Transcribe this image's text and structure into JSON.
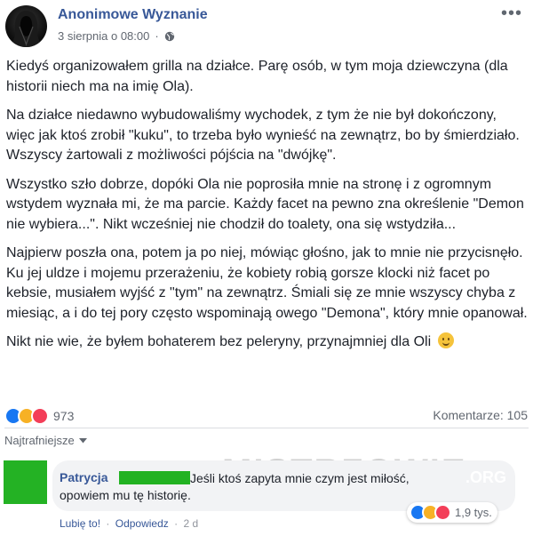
{
  "post": {
    "page_name": "Anonimowe Wyznanie",
    "date": "3 sierpnia o 08:00",
    "more_icon": "more-options-icon",
    "paragraphs": [
      "Kiedyś organizowałem grilla na działce. Parę osób, w tym moja dziewczyna (dla historii niech ma na imię Ola).",
      "Na działce niedawno wybudowaliśmy wychodek, z tym że nie był dokończony, więc jak ktoś zrobił \"kuku\", to trzeba było wynieść na zewnątrz, bo by śmierdziało. Wszyscy żartowali z możliwości pójścia na \"dwójkę\".",
      "Wszystko szło dobrze, dopóki Ola nie poprosiła mnie na stronę i z ogromnym wstydem wyznała mi, że ma parcie. Każdy facet na pewno zna określenie \"Demon nie wybiera...\". Nikt wcześniej nie chodził do toalety, ona się wstydziła...",
      "Najpierw poszła ona, potem ja po niej, mówiąc głośno, jak to mnie nie przycisnęło. Ku jej uldze i mojemu przerażeniu, że kobiety robią gorsze klocki niż facet po kebsie, musiałem wyjść z \"tym\" na zewnątrz. Śmiali się ze mnie wszyscy chyba z miesiąc, a i do tej pory często wspominają owego \"Demona\", który mnie opanował.",
      "Nikt nie wie, że byłem bohaterem bez peleryny, przynajmniej dla Oli"
    ],
    "reaction_count": "973",
    "comments_label": "Komentarze: 105"
  },
  "comments": {
    "sort_label": "Najtrafniejsze",
    "items": [
      {
        "author": "Patrycja",
        "text": "Jeśli ktoś zapyta mnie czym jest miłość, opowiem mu tę historię.",
        "like_label": "Lubię to!",
        "reply_label": "Odpowiedz",
        "time": "2 d",
        "reaction_count": "1,9 tys."
      }
    ]
  },
  "watermark": {
    "text": "MISTRZOWIE",
    "suffix": ".ORG"
  },
  "colors": {
    "link": "#385898",
    "text": "#1d2129",
    "meta": "#616770",
    "redaction": "#22b222"
  }
}
